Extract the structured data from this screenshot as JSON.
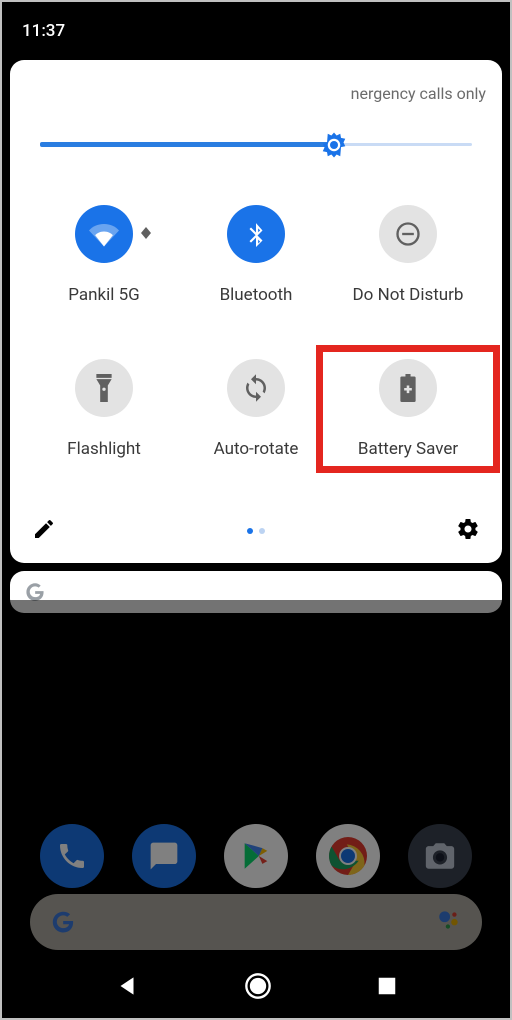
{
  "status": {
    "time": "11:37"
  },
  "panel": {
    "carrier_text": "nergency calls only",
    "brightness": {
      "percent": 68
    }
  },
  "tiles": [
    {
      "label": "Pankil 5G",
      "active": true,
      "icon": "wifi",
      "expandable": true
    },
    {
      "label": "Bluetooth",
      "active": true,
      "icon": "bluetooth",
      "expandable": false
    },
    {
      "label": "Do Not Disturb",
      "active": false,
      "icon": "dnd",
      "expandable": false
    },
    {
      "label": "Flashlight",
      "active": false,
      "icon": "flashlight",
      "expandable": false
    },
    {
      "label": "Auto-rotate",
      "active": false,
      "icon": "autorotate",
      "expandable": false
    },
    {
      "label": "Battery Saver",
      "active": false,
      "icon": "battery-saver",
      "expandable": false,
      "highlight": true
    }
  ],
  "pager": {
    "pages": 2,
    "current": 0
  },
  "colors": {
    "accent": "#1a73e8",
    "highlight_box": "#e4261f",
    "tile_off": "#e3e3e3",
    "icon_off": "#606060"
  },
  "dock_apps": [
    "Phone",
    "Messages",
    "Play Store",
    "Chrome",
    "Camera"
  ]
}
